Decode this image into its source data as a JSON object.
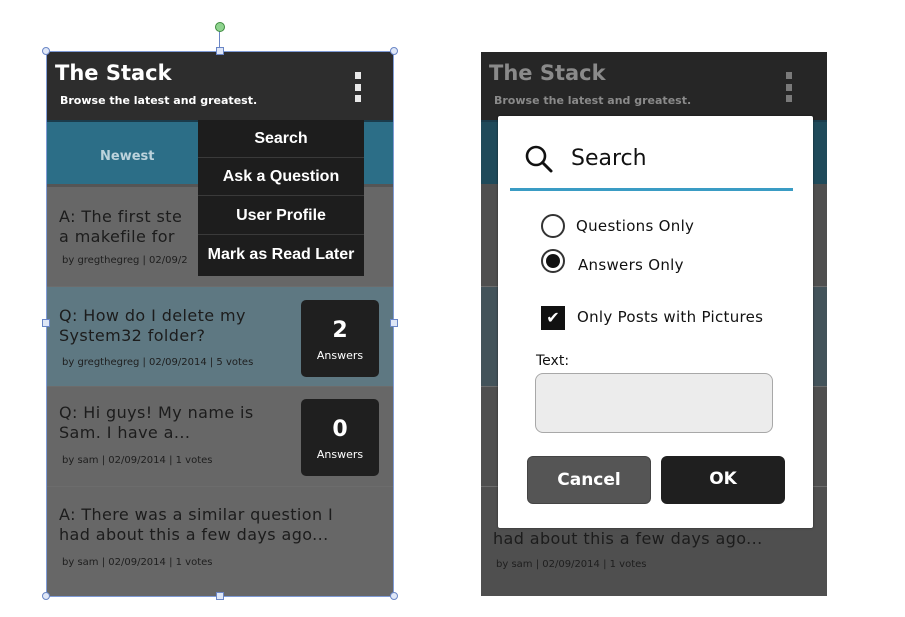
{
  "left_screen": {
    "app_title": "The Stack",
    "app_subtitle": "Browse the latest and greatest.",
    "overflow_icon": "more-vertical-icon",
    "tab_label": "Newest",
    "menu": [
      "Search",
      "Ask a Question",
      "User Profile",
      "Mark as Read Later"
    ],
    "rows": [
      {
        "title_line1": "A: The first ste",
        "title_line2": "a makefile for",
        "meta": "by gregthegreg | 02/09/2"
      },
      {
        "title_line1": "Q: How do I delete my",
        "title_line2": "System32 folder?",
        "meta": "by gregthegreg | 02/09/2014 | 5 votes",
        "answers_count": "2",
        "answers_label": "Answers"
      },
      {
        "title_line1": "Q: Hi guys! My name is",
        "title_line2": "Sam. I have a...",
        "meta": "by sam | 02/09/2014 | 1 votes",
        "answers_count": "0",
        "answers_label": "Answers"
      },
      {
        "title_line1": "A: There was a similar question I",
        "title_line2": "had about this a few days ago...",
        "meta": "by sam | 02/09/2014 | 1 votes"
      }
    ]
  },
  "right_screen": {
    "app_title": "The Stack",
    "app_subtitle": "Browse the latest and greatest.",
    "background_row_line2": "had about this a few days ago...",
    "background_row_meta": "by sam | 02/09/2014 | 1 votes",
    "dialog": {
      "icon": "search-icon",
      "title": "Search",
      "options": [
        {
          "label": "Questions Only",
          "selected": false
        },
        {
          "label": "Answers Only",
          "selected": true
        }
      ],
      "checkbox_label": "Only Posts with Pictures",
      "checkbox_checked": true,
      "text_label": "Text:",
      "text_value": "",
      "cancel_label": "Cancel",
      "ok_label": "OK"
    }
  },
  "colors": {
    "app_bar": "#2d2d2d",
    "tab_bar": "#2c6e87",
    "accent": "#3a9cc4",
    "selection": "#7f9bd6"
  }
}
